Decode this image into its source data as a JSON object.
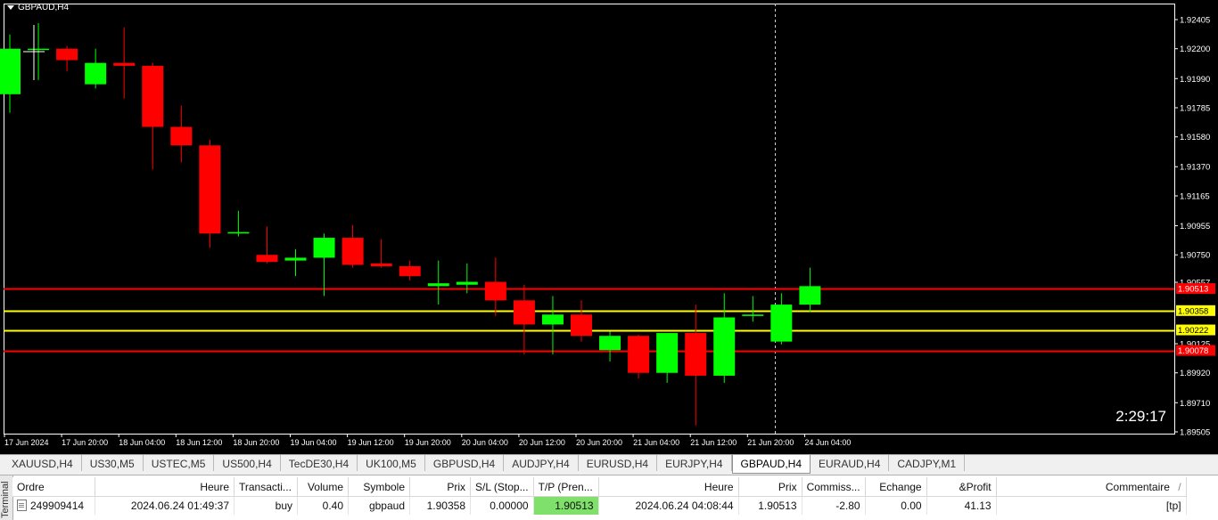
{
  "chart": {
    "title": "GBPAUD,H4",
    "timer": "2:29:17",
    "price_labels": [
      "1.92405",
      "1.92200",
      "1.91990",
      "1.91785",
      "1.91580",
      "1.91370",
      "1.91165",
      "1.90955",
      "1.90750",
      "1.90557",
      "1.90125",
      "1.89920",
      "1.89710",
      "1.89505"
    ],
    "time_labels": [
      "17 Jun 2024",
      "17 Jun 20:00",
      "18 Jun 04:00",
      "18 Jun 12:00",
      "18 Jun 20:00",
      "19 Jun 04:00",
      "19 Jun 12:00",
      "19 Jun 20:00",
      "20 Jun 04:00",
      "20 Jun 12:00",
      "20 Jun 20:00",
      "21 Jun 04:00",
      "21 Jun 12:00",
      "21 Jun 20:00",
      "24 Jun 04:00"
    ],
    "levels": [
      {
        "price": 1.90513,
        "label": "1.90513",
        "color": "#ff0000",
        "label_bg": "#ff0000",
        "label_fg": "#ffffff"
      },
      {
        "price": 1.90358,
        "label": "1.90358",
        "color": "#ffff00",
        "label_bg": "#ffff00",
        "label_fg": "#000000"
      },
      {
        "price": 1.90222,
        "label": "1.90222",
        "color": "#ffff00",
        "label_bg": "#ffff00",
        "label_fg": "#000000"
      },
      {
        "price": 1.90078,
        "label": "1.90078",
        "color": "#ff0000",
        "label_bg": "#ff0000",
        "label_fg": "#ffffff"
      }
    ],
    "bull_color": "#00ff00",
    "bear_color": "#ff0000",
    "candles": [
      {
        "o": 1.9188,
        "h": 1.923,
        "l": 1.9175,
        "c": 1.922
      },
      {
        "o": 1.922,
        "h": 1.9238,
        "l": 1.9198,
        "c": 1.922
      },
      {
        "o": 1.922,
        "h": 1.9222,
        "l": 1.9204,
        "c": 1.9212
      },
      {
        "o": 1.9195,
        "h": 1.922,
        "l": 1.9192,
        "c": 1.921
      },
      {
        "o": 1.921,
        "h": 1.9235,
        "l": 1.9185,
        "c": 1.9208
      },
      {
        "o": 1.9208,
        "h": 1.921,
        "l": 1.9135,
        "c": 1.9165
      },
      {
        "o": 1.9165,
        "h": 1.918,
        "l": 1.914,
        "c": 1.9152
      },
      {
        "o": 1.9152,
        "h": 1.9156,
        "l": 1.908,
        "c": 1.909
      },
      {
        "o": 1.909,
        "h": 1.9106,
        "l": 1.9088,
        "c": 1.9091
      },
      {
        "o": 1.9075,
        "h": 1.9095,
        "l": 1.9069,
        "c": 1.907
      },
      {
        "o": 1.9071,
        "h": 1.9079,
        "l": 1.906,
        "c": 1.9073
      },
      {
        "o": 1.9073,
        "h": 1.909,
        "l": 1.9046,
        "c": 1.9087
      },
      {
        "o": 1.9087,
        "h": 1.9096,
        "l": 1.9066,
        "c": 1.9068
      },
      {
        "o": 1.9069,
        "h": 1.9086,
        "l": 1.9066,
        "c": 1.9067
      },
      {
        "o": 1.9067,
        "h": 1.9071,
        "l": 1.9057,
        "c": 1.906
      },
      {
        "o": 1.9053,
        "h": 1.9071,
        "l": 1.904,
        "c": 1.9055
      },
      {
        "o": 1.9054,
        "h": 1.9069,
        "l": 1.9048,
        "c": 1.9056
      },
      {
        "o": 1.9056,
        "h": 1.9073,
        "l": 1.9032,
        "c": 1.9043
      },
      {
        "o": 1.9043,
        "h": 1.9054,
        "l": 1.9005,
        "c": 1.9026
      },
      {
        "o": 1.9026,
        "h": 1.9046,
        "l": 1.9005,
        "c": 1.9033
      },
      {
        "o": 1.9033,
        "h": 1.9043,
        "l": 1.9014,
        "c": 1.9018
      },
      {
        "o": 1.9008,
        "h": 1.9021,
        "l": 1.9,
        "c": 1.9018
      },
      {
        "o": 1.9018,
        "h": 1.9019,
        "l": 1.8988,
        "c": 1.8992
      },
      {
        "o": 1.8992,
        "h": 1.902,
        "l": 1.8985,
        "c": 1.902
      },
      {
        "o": 1.902,
        "h": 1.904,
        "l": 1.8955,
        "c": 1.899
      },
      {
        "o": 1.899,
        "h": 1.9048,
        "l": 1.8985,
        "c": 1.9031
      },
      {
        "o": 1.9032,
        "h": 1.9046,
        "l": 1.9028,
        "c": 1.9033
      },
      {
        "o": 1.9014,
        "h": 1.9048,
        "l": 1.9012,
        "c": 1.904
      },
      {
        "o": 1.904,
        "h": 1.9066,
        "l": 1.9035,
        "c": 1.9053
      }
    ]
  },
  "tabs": [
    "XAUUSD,H4",
    "US30,M5",
    "USTEC,M5",
    "US500,H4",
    "TecDE30,H4",
    "UK100,M5",
    "GBPUSD,H4",
    "AUDJPY,H4",
    "EURUSD,H4",
    "EURJPY,H4",
    "GBPAUD,H4",
    "EURAUD,H4",
    "CADJPY,M1"
  ],
  "active_tab": "GBPAUD,H4",
  "terminal": {
    "side_label": "Terminal",
    "headers": [
      "Ordre",
      "Heure",
      "Transacti...",
      "Volume",
      "Symbole",
      "Prix",
      "S/L (Stop...",
      "T/P (Pren...",
      "Heure",
      "Prix",
      "Commiss...",
      "Echange",
      "&Profit",
      "Commentaire"
    ],
    "row": {
      "ordre": "249909414",
      "heure": "2024.06.24 01:49:37",
      "type": "buy",
      "volume": "0.40",
      "symbole": "gbpaud",
      "prix": "1.90358",
      "sl": "0.00000",
      "tp": "1.90513",
      "heure2": "2024.06.24 04:08:44",
      "prix2": "1.90513",
      "commission": "-2.80",
      "echange": "0.00",
      "profit": "41.13",
      "commentaire": "[tp]"
    },
    "tp_highlight": "#7fe06a"
  }
}
